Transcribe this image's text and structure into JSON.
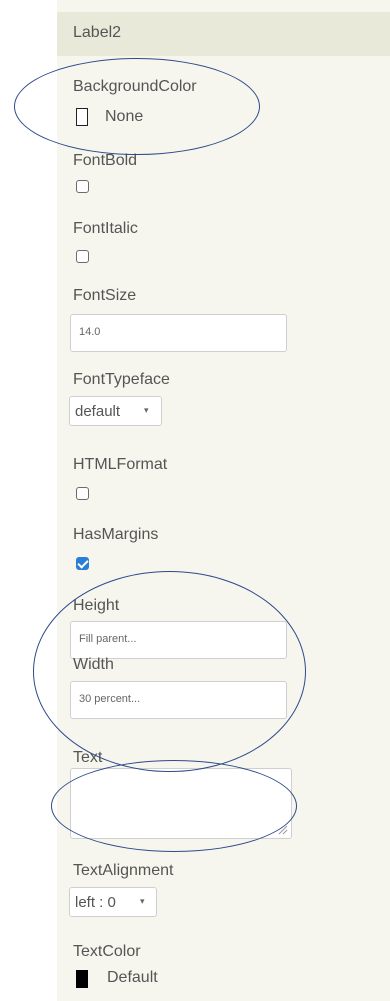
{
  "header": {
    "title": "Label2"
  },
  "properties": {
    "background_color": {
      "label": "BackgroundColor",
      "value": "None"
    },
    "font_bold": {
      "label": "FontBold",
      "checked": false
    },
    "font_italic": {
      "label": "FontItalic",
      "checked": false
    },
    "font_size": {
      "label": "FontSize",
      "value": "14.0"
    },
    "font_typeface": {
      "label": "FontTypeface",
      "value": "default",
      "arrow": "▾"
    },
    "html_format": {
      "label": "HTMLFormat",
      "checked": false
    },
    "has_margins": {
      "label": "HasMargins",
      "checked": true
    },
    "height": {
      "label": "Height",
      "value": "Fill parent..."
    },
    "width": {
      "label": "Width",
      "value": "30 percent..."
    },
    "text": {
      "label": "Text",
      "value": ""
    },
    "text_alignment": {
      "label": "TextAlignment",
      "value": "left : 0",
      "arrow": "▾"
    },
    "text_color": {
      "label": "TextColor",
      "value": "Default"
    }
  },
  "colors": {
    "panel_bg": "#f6f6ee",
    "header_bg": "#e9e9da",
    "annotation_ring": "#2e4a8a",
    "checkbox_checked": "#2a7fd4",
    "text_color_swatch": "#000000"
  }
}
